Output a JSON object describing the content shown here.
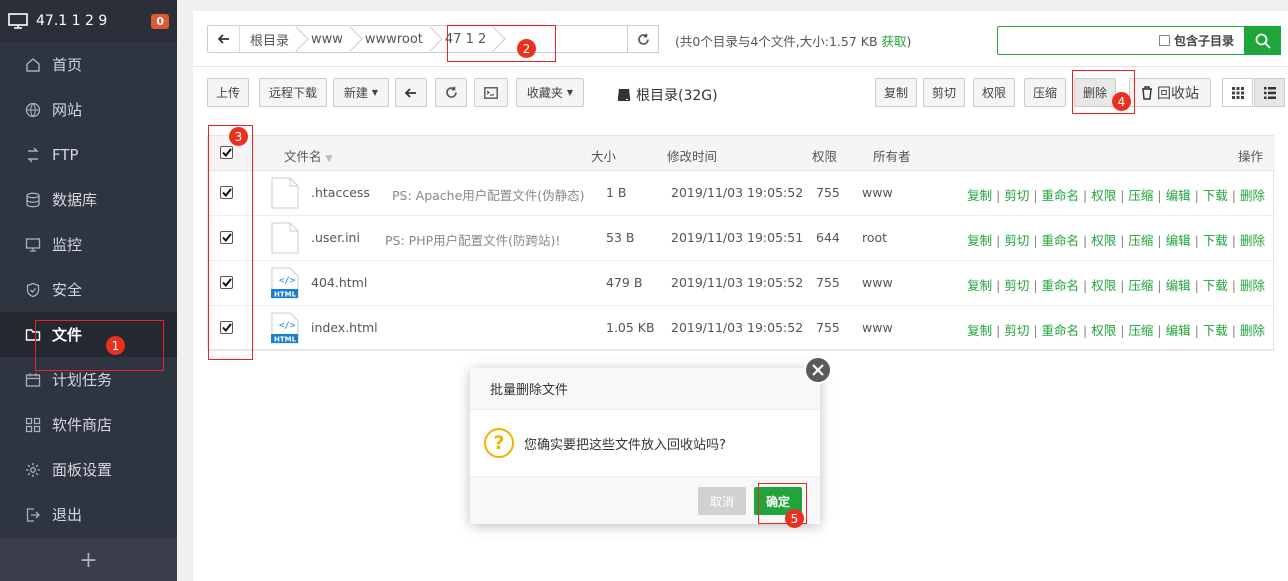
{
  "sidebar": {
    "server_ip": "47.1  1  2  9",
    "badge": "0",
    "items": [
      {
        "label": "首页",
        "icon": "home-icon"
      },
      {
        "label": "网站",
        "icon": "globe-icon"
      },
      {
        "label": "FTP",
        "icon": "ftp-icon"
      },
      {
        "label": "数据库",
        "icon": "database-icon"
      },
      {
        "label": "监控",
        "icon": "monitor-icon"
      },
      {
        "label": "安全",
        "icon": "shield-icon"
      },
      {
        "label": "文件",
        "icon": "folder-icon",
        "active": true
      },
      {
        "label": "计划任务",
        "icon": "calendar-icon"
      },
      {
        "label": "软件商店",
        "icon": "apps-icon"
      },
      {
        "label": "面板设置",
        "icon": "gear-icon"
      },
      {
        "label": "退出",
        "icon": "logout-icon"
      }
    ],
    "footer": "+"
  },
  "pathbar": {
    "crumbs": [
      "根目录",
      "www",
      "wwwroot",
      "47  1  2  "
    ]
  },
  "summary": {
    "text": "(共0个目录与4个文件,大小:1.57 KB ",
    "link": "获取",
    "close": ")"
  },
  "search": {
    "placeholder": "",
    "subdir_label": "包含子目录"
  },
  "toolbar": {
    "upload": "上传",
    "remote_download": "远程下载",
    "new": "新建",
    "favorites": "收藏夹",
    "disk": "根目录(32G)",
    "copy": "复制",
    "cut": "剪切",
    "permission": "权限",
    "compress": "压缩",
    "delete": "删除",
    "recycle": "回收站"
  },
  "table": {
    "headers": {
      "name": "文件名",
      "size": "大小",
      "mtime": "修改时间",
      "perm": "权限",
      "owner": "所有者",
      "ops": "操作"
    },
    "ops": [
      "复制",
      "剪切",
      "重命名",
      "权限",
      "压缩",
      "编辑",
      "下载",
      "删除"
    ],
    "rows": [
      {
        "name": ".htaccess",
        "ps": "PS: Apache用户配置文件(伪静态)",
        "size": "1 B",
        "mtime": "2019/11/03 19:05:52",
        "perm": "755",
        "owner": "www",
        "type": "file"
      },
      {
        "name": ".user.ini",
        "ps": "PS: PHP用户配置文件(防跨站)!",
        "size": "53 B",
        "mtime": "2019/11/03 19:05:51",
        "perm": "644",
        "owner": "root",
        "type": "file"
      },
      {
        "name": "404.html",
        "ps": "",
        "size": "479 B",
        "mtime": "2019/11/03 19:05:52",
        "perm": "755",
        "owner": "www",
        "type": "html"
      },
      {
        "name": "index.html",
        "ps": "",
        "size": "1.05 KB",
        "mtime": "2019/11/03 19:05:52",
        "perm": "755",
        "owner": "www",
        "type": "html"
      }
    ]
  },
  "dialog": {
    "title": "批量删除文件",
    "message": "您确实要把这些文件放入回收站吗?",
    "cancel": "取消",
    "ok": "确定"
  },
  "annotations": [
    "1",
    "2",
    "3",
    "4",
    "5"
  ],
  "colors": {
    "accent": "#20a53a",
    "sidebar_bg": "#2e3440",
    "marker": "#e8321f"
  }
}
